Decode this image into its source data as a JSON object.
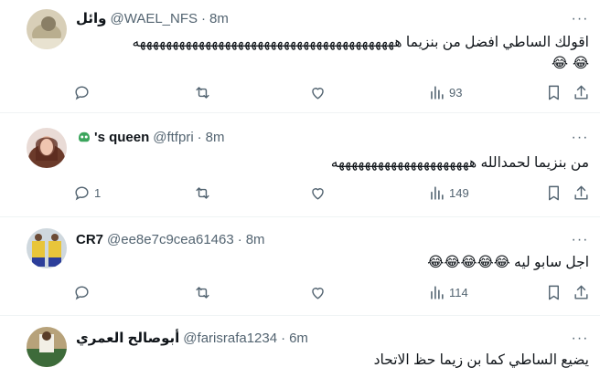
{
  "tweets": [
    {
      "name": "وائل",
      "handle": "@WAEL_NFS",
      "sep": "·",
      "time": "8m",
      "text": "اقولك الساطي افضل من بنزيما ههههههههههههههههههههههههههههههههههههههههه",
      "emoji_line": "😂 😂",
      "reply_count": "",
      "views": "93"
    },
    {
      "name": "'s queen",
      "handle": "@ftfpri",
      "sep": "·",
      "time": "8m",
      "text": "من بنزيما لحمدالله هههههههههههههههههههههه",
      "emoji_line": "",
      "reply_count": "1",
      "views": "149"
    },
    {
      "name": "CR7",
      "handle": "@ee8e7c9cea61463",
      "sep": "·",
      "time": "8m",
      "text": "اجل سابو ليه",
      "emoji_line": "😂😂😂😂😂",
      "reply_count": "",
      "views": "114"
    },
    {
      "name": "أبوصالح العمري",
      "handle": "@farisrafa1234",
      "sep": "·",
      "time": "6m",
      "text": "يضيع الساطي كما بن زيما حظ الاتحاد",
      "emoji_line": "",
      "reply_count": "",
      "views": ""
    }
  ],
  "more_label": "···",
  "colors": {
    "text": "#0f1419",
    "secondary": "#536471",
    "border": "#eff3f4",
    "green_icon": "#3ba55c"
  }
}
